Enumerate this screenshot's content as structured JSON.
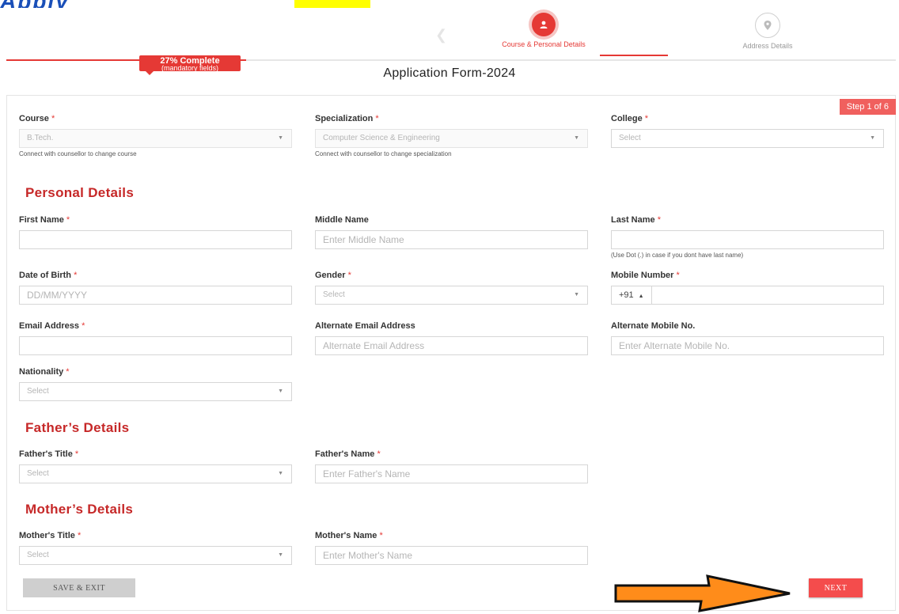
{
  "colors": {
    "accent": "#e53935",
    "heading": "#c62828",
    "arrow": "#ff8c1a"
  },
  "header": {
    "banner_text": "Apply"
  },
  "stepper": {
    "steps": [
      {
        "label": "Course & Personal Details",
        "icon": "user-icon",
        "active": true
      },
      {
        "label": "Address Details",
        "icon": "location-pin-icon",
        "active": false
      }
    ]
  },
  "progress": {
    "value": 0.27,
    "percent_label": "27% Complete",
    "sub_label": "(mandatory fields)"
  },
  "form": {
    "title": "Application Form-2024",
    "step_badge": "Step 1 of 6",
    "course": {
      "label": "Course",
      "value": "B.Tech.",
      "note": "Connect with counsellor to change course"
    },
    "specialization": {
      "label": "Specialization",
      "value": "Computer Science & Engineering",
      "note": "Connect with counsellor to change specialization"
    },
    "college": {
      "label": "College",
      "value": "Select"
    },
    "personal": {
      "title": "Personal Details",
      "first_name": {
        "label": "First Name",
        "value": ""
      },
      "middle_name": {
        "label": "Middle Name",
        "placeholder": "Enter Middle Name"
      },
      "last_name": {
        "label": "Last Name",
        "value": "",
        "note": "(Use Dot (.) in case if you dont have last name)"
      },
      "dob": {
        "label": "Date of Birth",
        "placeholder": "DD/MM/YYYY"
      },
      "gender": {
        "label": "Gender",
        "value": "Select"
      },
      "mobile": {
        "label": "Mobile Number",
        "country_code": "+91",
        "value": ""
      },
      "email": {
        "label": "Email Address",
        "value": ""
      },
      "alt_email": {
        "label": "Alternate Email Address",
        "placeholder": "Alternate Email Address"
      },
      "alt_mobile": {
        "label": "Alternate Mobile No.",
        "placeholder": "Enter Alternate Mobile No."
      },
      "nationality": {
        "label": "Nationality",
        "value": "Select"
      }
    },
    "father": {
      "title": "Father’s Details",
      "title_field": {
        "label": "Father's Title",
        "value": "Select"
      },
      "name": {
        "label": "Father's Name",
        "placeholder": "Enter Father's Name"
      }
    },
    "mother": {
      "title": "Mother’s Details",
      "title_field": {
        "label": "Mother's Title",
        "value": "Select"
      },
      "name": {
        "label": "Mother's Name",
        "placeholder": "Enter Mother's Name"
      }
    },
    "required_mark": "*",
    "caret": "▼"
  },
  "actions": {
    "save_exit": "SAVE & EXIT",
    "next": "NEXT"
  }
}
